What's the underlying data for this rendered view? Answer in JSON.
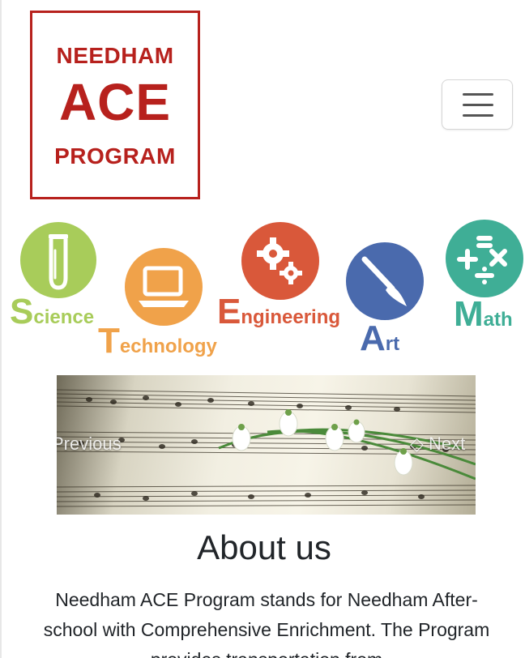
{
  "logo": {
    "line1": "NEEDHAM",
    "line2": "ACE",
    "line3": "PROGRAM",
    "color": "#b7211d"
  },
  "nav": {
    "toggle_icon": "hamburger-menu-icon"
  },
  "steam": {
    "science": {
      "cap": "S",
      "rest": "cience",
      "icon": "test-tube-icon",
      "color": "#a8cc5a"
    },
    "technology": {
      "cap": "T",
      "rest": "echnology",
      "icon": "laptop-icon",
      "color": "#f0a24a"
    },
    "engineering": {
      "cap": "E",
      "rest": "ngineering",
      "icon": "gears-icon",
      "color": "#d9583a"
    },
    "art": {
      "cap": "A",
      "rest": "rt",
      "icon": "paintbrush-icon",
      "color": "#4a6aad"
    },
    "math": {
      "cap": "M",
      "rest": "ath",
      "icon": "math-symbols-icon",
      "color": "#3fae96"
    }
  },
  "carousel": {
    "prev_label": "Previous",
    "next_label": "Next"
  },
  "about": {
    "title": "About us",
    "body": "Needham ACE Program stands for Needham After-school with Comprehensive Enrichment. The Program provides transportation from"
  }
}
